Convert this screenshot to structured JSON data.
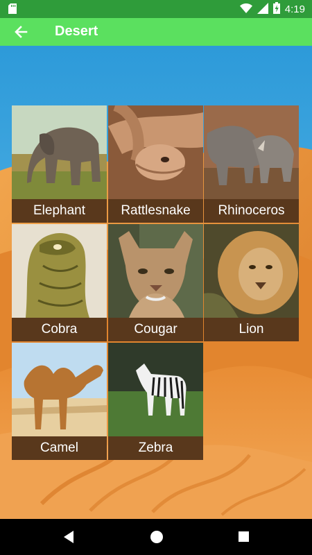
{
  "status_bar": {
    "time": "4:19",
    "icons": [
      "sd-card-icon",
      "wifi-icon",
      "signal-icon",
      "battery-charging-icon"
    ]
  },
  "app_bar": {
    "title": "Desert",
    "back_icon": "arrow-back-icon"
  },
  "animals": [
    {
      "name": "Elephant"
    },
    {
      "name": "Rattlesnake"
    },
    {
      "name": "Rhinoceros"
    },
    {
      "name": "Cobra"
    },
    {
      "name": "Cougar"
    },
    {
      "name": "Lion"
    },
    {
      "name": "Camel"
    },
    {
      "name": "Zebra"
    }
  ],
  "nav_bar": {
    "icons": [
      "back-triangle-icon",
      "home-circle-icon",
      "recents-square-icon"
    ]
  },
  "colors": {
    "status_bar": "#2f9c3a",
    "app_bar": "#5be05f",
    "sky": "#3aa9e0",
    "sand": "#e8923a",
    "caption_bg": "#46260e"
  }
}
